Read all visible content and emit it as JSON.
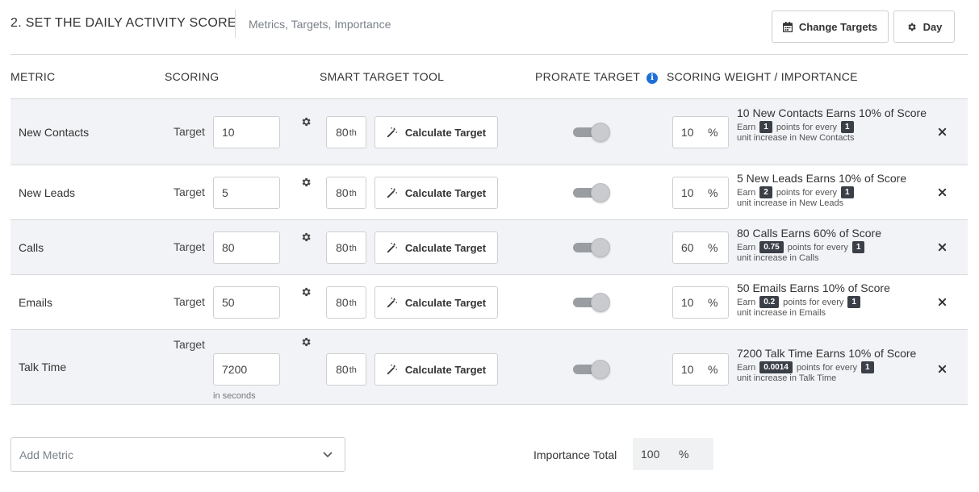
{
  "header": {
    "title": "2.  SET THE DAILY ACTIVITY SCORE",
    "subtitle": "Metrics, Targets, Importance",
    "change_targets_label": "Change Targets",
    "day_label": "Day"
  },
  "columns": {
    "metric": "METRIC",
    "scoring": "SCORING",
    "smart_target": "SMART TARGET TOOL",
    "prorate": "PRORATE TARGET",
    "weight": "SCORING WEIGHT / IMPORTANCE"
  },
  "labels": {
    "target": "Target",
    "calculate": "Calculate Target",
    "percentile": "80",
    "percentile_suffix": "th",
    "percent_sign": "%",
    "earn": "Earn",
    "points_for_every": "points for every",
    "unit_increase_in": "unit increase in",
    "in_seconds": "in seconds"
  },
  "metrics": [
    {
      "name": "New Contacts",
      "target": "10",
      "weight": "10",
      "title": "10 New Contacts Earns 10% of Score",
      "points": "1",
      "per": "1",
      "unit_line": "unit increase in New Contacts",
      "prorate": true
    },
    {
      "name": "New Leads",
      "target": "5",
      "weight": "10",
      "title": "5 New Leads Earns 10% of Score",
      "points": "2",
      "per": "1",
      "unit_line": "unit increase in New Leads",
      "prorate": true
    },
    {
      "name": "Calls",
      "target": "80",
      "weight": "60",
      "title": "80 Calls Earns 60% of Score",
      "points": "0.75",
      "per": "1",
      "unit_line": "unit increase in Calls",
      "prorate": true
    },
    {
      "name": "Emails",
      "target": "50",
      "weight": "10",
      "title": "50 Emails Earns 10% of Score",
      "points": "0.2",
      "per": "1",
      "unit_line": "unit increase in Emails",
      "prorate": true
    },
    {
      "name": "Talk Time",
      "target": "7200",
      "weight": "10",
      "title": "7200 Talk Time Earns 10% of Score",
      "points": "0.0014",
      "per": "1",
      "unit_line": "unit increase in Talk Time",
      "prorate": true
    }
  ],
  "footer": {
    "add_metric_placeholder": "Add Metric",
    "importance_label": "Importance Total",
    "importance_total": "100",
    "percent_sign": "%"
  },
  "colors": {
    "info_icon": "#1f6fd8",
    "row_shade": "#f2f3f6",
    "chip_bg": "#3b3f47",
    "toggle_track": "#9a9da2"
  }
}
